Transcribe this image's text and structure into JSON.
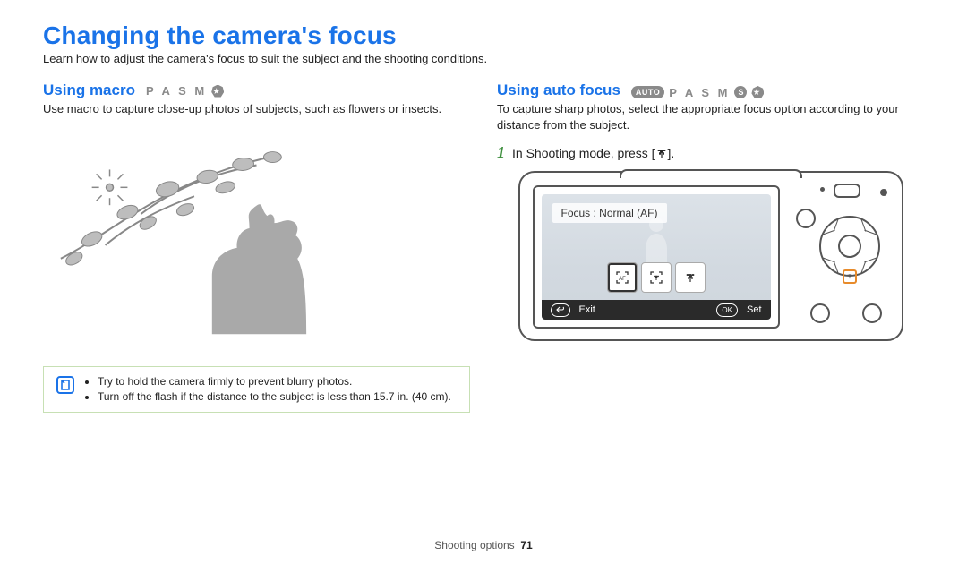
{
  "title": "Changing the camera's focus",
  "subtitle": "Learn how to adjust the camera's focus to suit the subject and the shooting conditions.",
  "left": {
    "heading": "Using macro",
    "modes_text": "P A S M",
    "body": "Use macro to capture close-up photos of subjects, such as flowers or insects.",
    "note_items": [
      "Try to hold the camera firmly to prevent blurry photos.",
      "Turn off the flash if the distance to the subject is less than 15.7 in. (40 cm)."
    ]
  },
  "right": {
    "heading": "Using auto focus",
    "mode_auto": "AUTO",
    "modes_text": "P A S M",
    "mode_s": "S",
    "body": "To capture sharp photos, select the appropriate focus option according to your distance from the subject.",
    "step_number": "1",
    "step_text_prefix": "In Shooting mode, press [",
    "step_text_suffix": "].",
    "screen": {
      "focus_label": "Focus : Normal (AF)",
      "exit_label": "Exit",
      "set_label": "Set",
      "ok_key": "OK"
    }
  },
  "footer": {
    "section": "Shooting options",
    "page": "71"
  }
}
